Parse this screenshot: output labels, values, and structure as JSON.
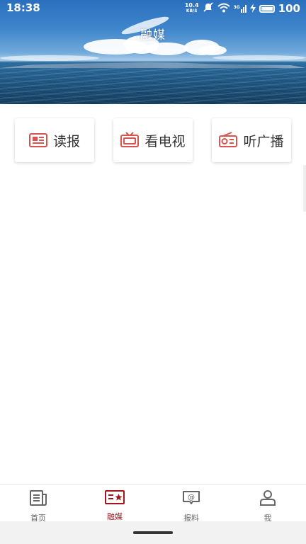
{
  "status_bar": {
    "time": "18:38",
    "net_speed_value": "10.4",
    "net_speed_unit": "KB/S",
    "signal_label": "3G",
    "battery": "100"
  },
  "header": {
    "title": "融媒"
  },
  "media_cards": [
    {
      "label": "读报",
      "icon": "newspaper-icon"
    },
    {
      "label": "看电视",
      "icon": "tv-icon"
    },
    {
      "label": "听广播",
      "icon": "radio-icon"
    }
  ],
  "bottom_nav": {
    "active_index": 1,
    "items": [
      {
        "label": "首页",
        "icon": "news-icon"
      },
      {
        "label": "融媒",
        "icon": "media-star-icon"
      },
      {
        "label": "报料",
        "icon": "chat-at-icon"
      },
      {
        "label": "我",
        "icon": "person-icon"
      }
    ]
  },
  "colors": {
    "accent": "#a3171c",
    "icon_red": "#d9534f",
    "inactive": "#666666"
  }
}
